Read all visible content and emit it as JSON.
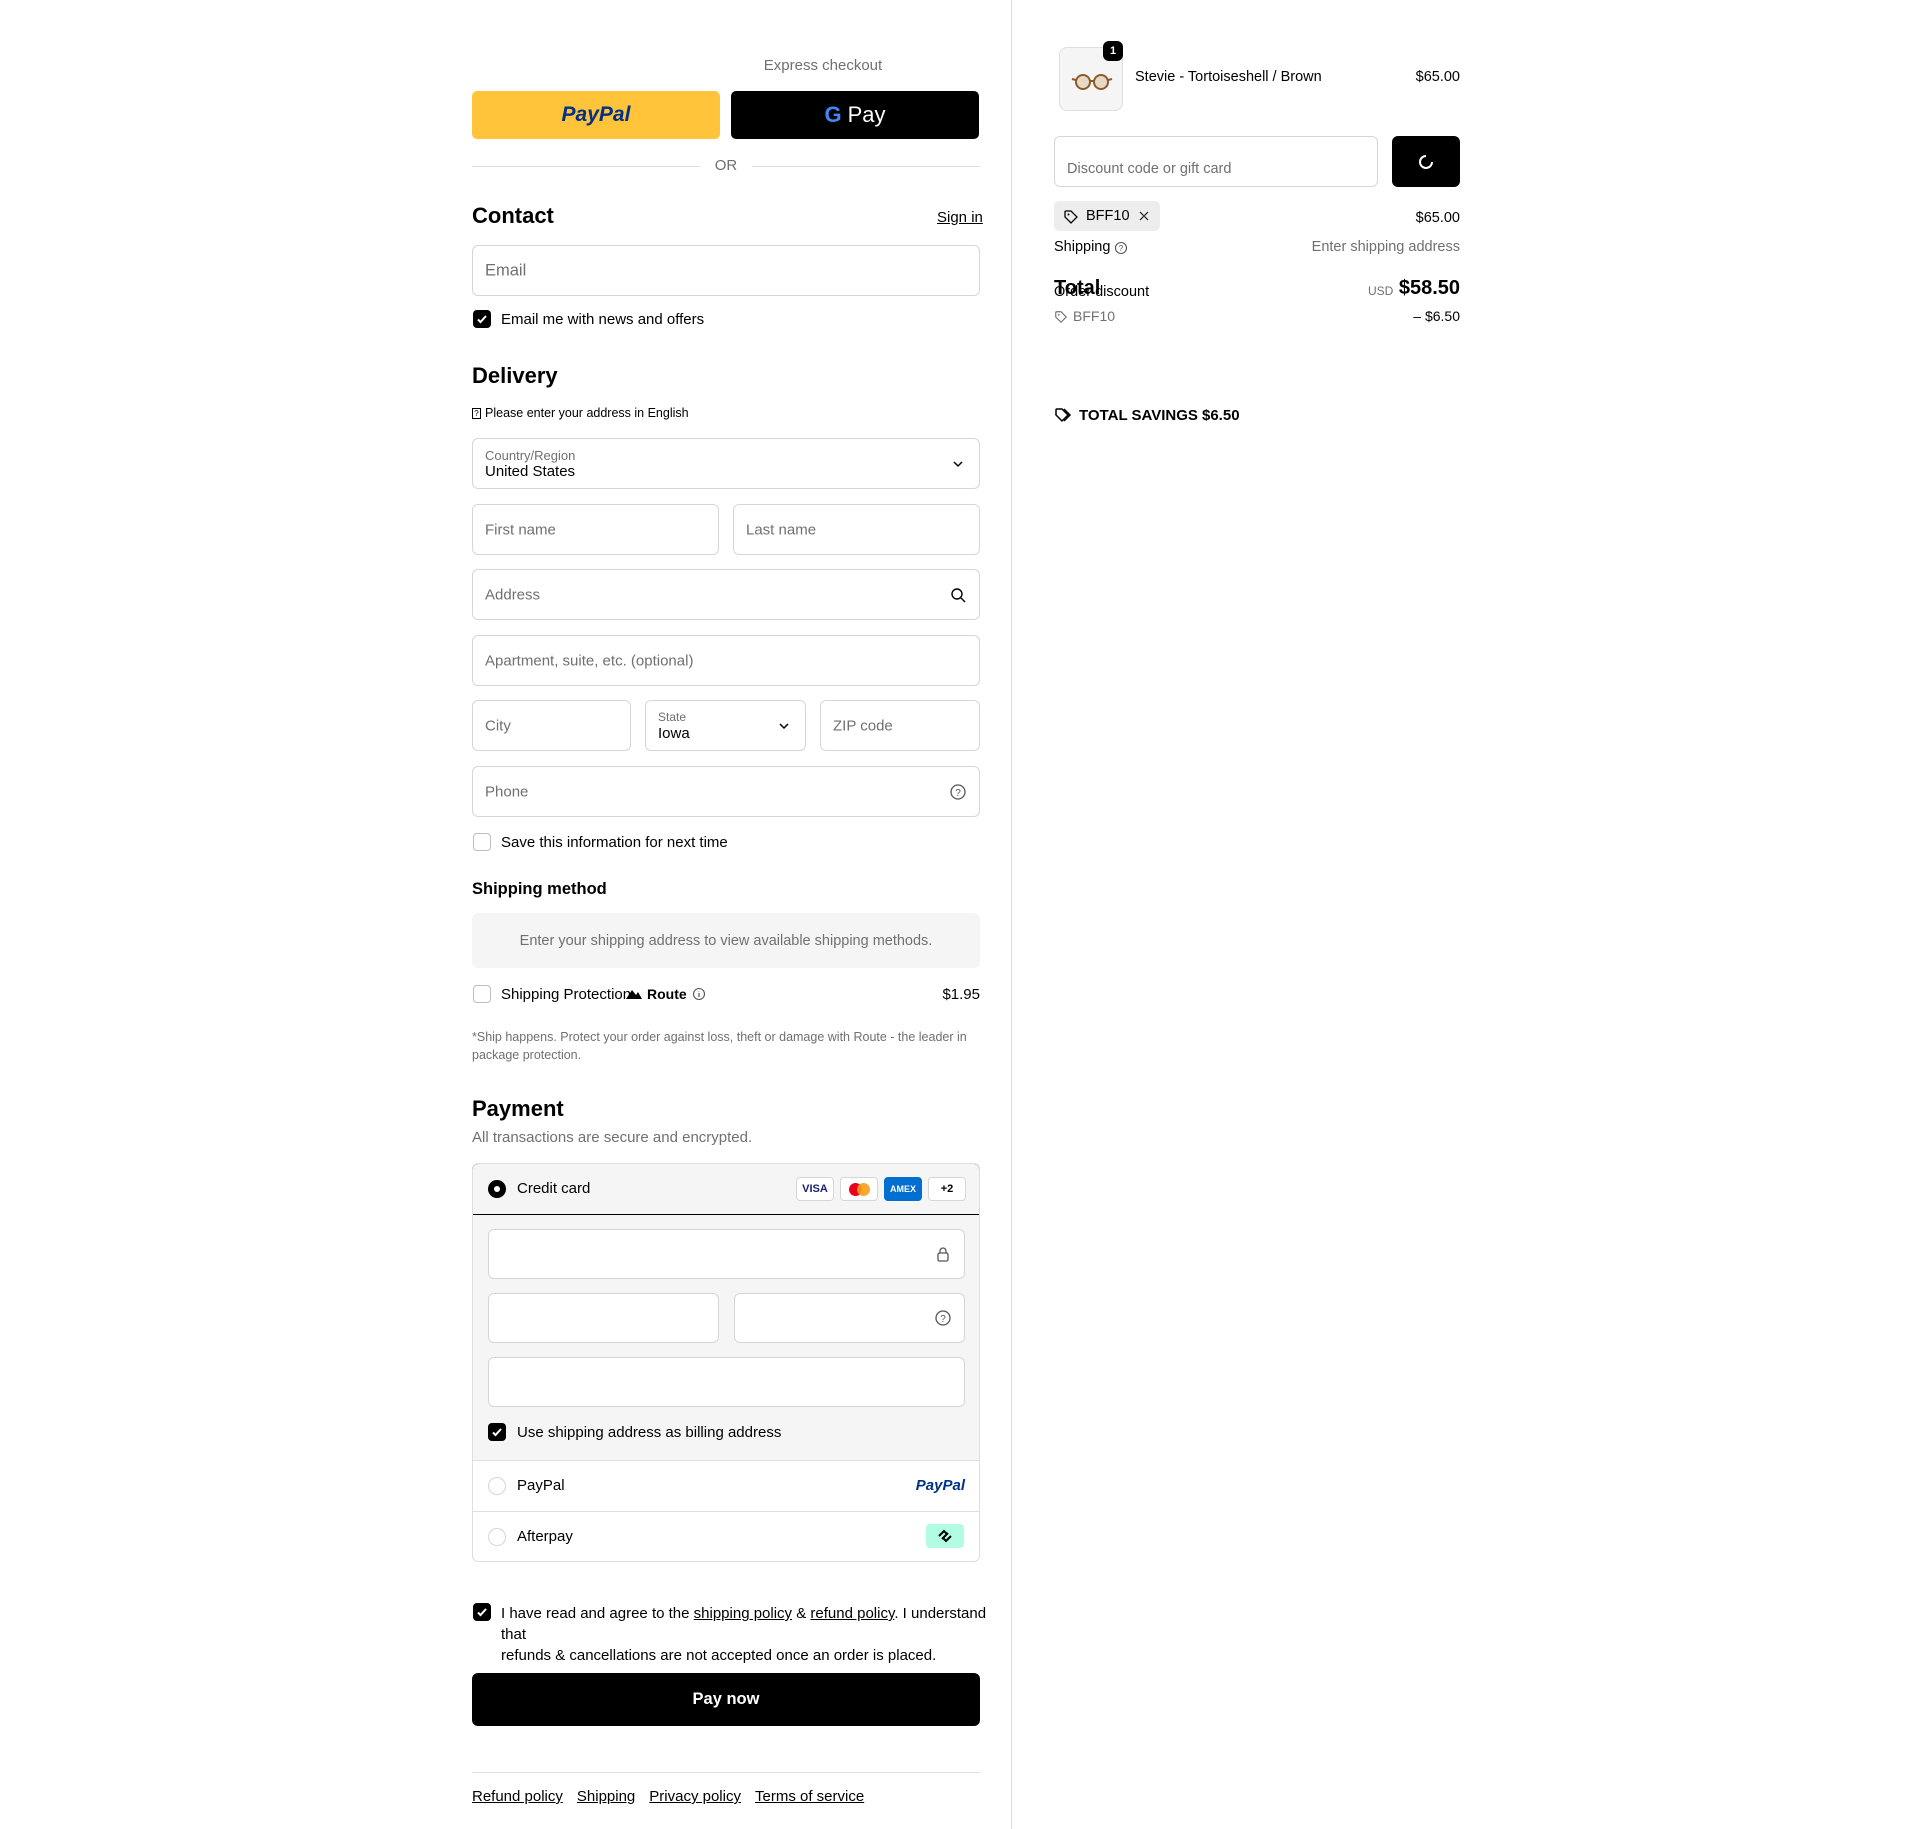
{
  "express": {
    "title": "Express checkout",
    "paypal_label": "PayPal",
    "gpay_label": "Pay",
    "or_label": "OR"
  },
  "contact": {
    "heading": "Contact",
    "sign_in": "Sign in",
    "email_placeholder": "Email",
    "news_label": "Email me with news and offers",
    "news_checked": true
  },
  "delivery": {
    "heading": "Delivery",
    "note": "Please enter your address in English",
    "country_label": "Country/Region",
    "country_value": "United States",
    "first_name": "First name",
    "last_name": "Last name",
    "address": "Address",
    "apartment": "Apartment, suite, etc. (optional)",
    "city": "City",
    "state_label": "State",
    "state_value": "Iowa",
    "zip": "ZIP code",
    "phone": "Phone",
    "save_label": "Save this information for next time",
    "save_checked": false
  },
  "shipping_method": {
    "heading": "Shipping method",
    "placeholder": "Enter your shipping address to view available shipping methods.",
    "protection_label": "Shipping Protection",
    "route_label": "Route",
    "protection_price": "$1.95",
    "protection_note": "*Ship happens. Protect your order against loss, theft or damage with Route - the leader in package protection."
  },
  "payment": {
    "heading": "Payment",
    "subtitle": "All transactions are secure and encrypted.",
    "credit_card_label": "Credit card",
    "card_badges": [
      "VISA",
      "MC",
      "AMEX",
      "+2"
    ],
    "billing_label": "Use shipping address as billing address",
    "billing_checked": true,
    "paypal_option": "PayPal",
    "paypal_logo": "PayPal",
    "afterpay_option": "Afterpay"
  },
  "agreement": {
    "text_before": "I have read and agree to the ",
    "shipping_policy": "shipping policy",
    "amp": " & ",
    "refund_policy": "refund policy",
    "text_after": ". I understand that",
    "line2": "refunds & cancellations are not accepted once an order is placed.",
    "checked": true
  },
  "pay_now": "Pay now",
  "footer_links": [
    "Refund policy",
    "Shipping",
    "Privacy policy",
    "Terms of service"
  ],
  "summary": {
    "item_qty": "1",
    "item_name": "Stevie - Tortoiseshell / Brown",
    "item_price": "$65.00",
    "discount_placeholder": "Discount code or gift card",
    "applied_code": "BFF10",
    "subtotal_value": "$65.00",
    "shipping_label": "Shipping",
    "shipping_value": "Enter shipping address",
    "order_discount_label": "Order discount",
    "total_label": "Total",
    "currency": "USD",
    "total_value": "$58.50",
    "discount_code": "BFF10",
    "discount_value": "– $6.50",
    "savings_label": "TOTAL SAVINGS",
    "savings_value": "$6.50"
  },
  "colors": {
    "paypal_yellow": "#ffc439",
    "accent": "#000000",
    "afterpay_mint": "#b2fce4"
  }
}
